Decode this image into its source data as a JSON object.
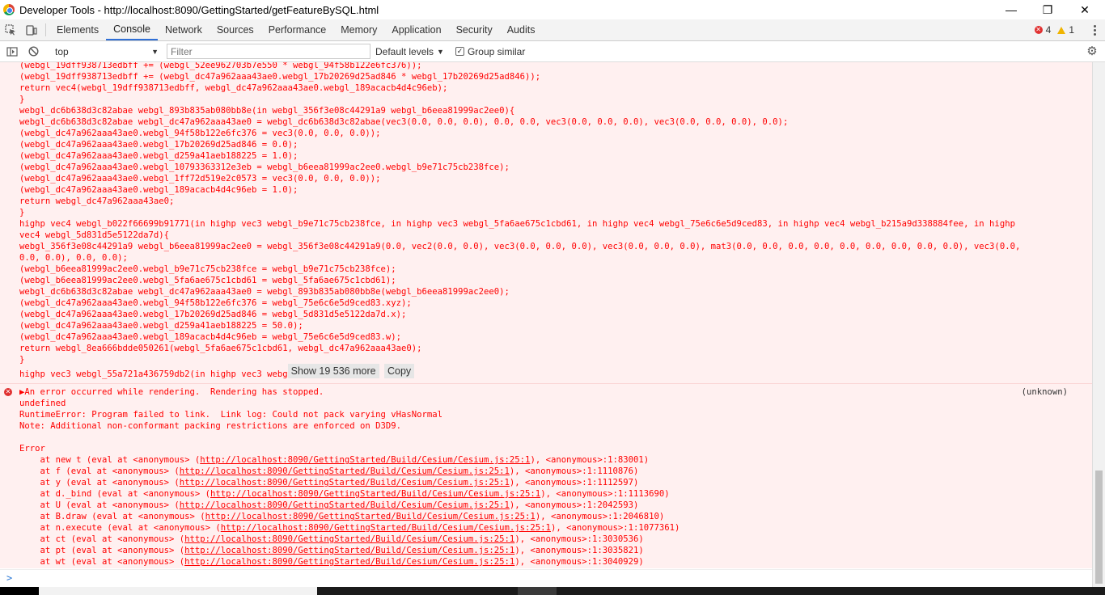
{
  "window": {
    "title": "Developer Tools - http://localhost:8090/GettingStarted/getFeatureBySQL.html",
    "minimize": "—",
    "restore": "❐",
    "close": "✕"
  },
  "tabs": [
    "Elements",
    "Console",
    "Network",
    "Sources",
    "Performance",
    "Memory",
    "Application",
    "Security",
    "Audits"
  ],
  "active_tab": "Console",
  "counts": {
    "errors": "4",
    "warnings": "1"
  },
  "toolbar": {
    "context": "top",
    "filter_placeholder": "Filter",
    "levels": "Default levels",
    "group_similar": "Group similar"
  },
  "code_lines": [
    "(webgl_19dff938713edbff += (webgl_52ee962703b7e550 * webgl_94f58b122e6fc376));",
    "(webgl_19dff938713edbff += (webgl_dc47a962aaa43ae0.webgl_17b20269d25ad846 * webgl_17b20269d25ad846));",
    "return vec4(webgl_19dff938713edbff, webgl_dc47a962aaa43ae0.webgl_189acacb4d4c96eb);",
    "}",
    "webgl_dc6b638d3c82abae webgl_893b835ab080bb8e(in webgl_356f3e08c44291a9 webgl_b6eea81999ac2ee0){",
    "webgl_dc6b638d3c82abae webgl_dc47a962aaa43ae0 = webgl_dc6b638d3c82abae(vec3(0.0, 0.0, 0.0), 0.0, 0.0, vec3(0.0, 0.0, 0.0), vec3(0.0, 0.0, 0.0), 0.0);",
    "(webgl_dc47a962aaa43ae0.webgl_94f58b122e6fc376 = vec3(0.0, 0.0, 0.0));",
    "(webgl_dc47a962aaa43ae0.webgl_17b20269d25ad846 = 0.0);",
    "(webgl_dc47a962aaa43ae0.webgl_d259a41aeb188225 = 1.0);",
    "(webgl_dc47a962aaa43ae0.webgl_10793363312e3eb = webgl_b6eea81999ac2ee0.webgl_b9e71c75cb238fce);",
    "(webgl_dc47a962aaa43ae0.webgl_1ff72d519e2c0573 = vec3(0.0, 0.0, 0.0));",
    "(webgl_dc47a962aaa43ae0.webgl_189acacb4d4c96eb = 1.0);",
    "return webgl_dc47a962aaa43ae0;",
    "}",
    "highp vec4 webgl_b022f66699b91771(in highp vec3 webgl_b9e71c75cb238fce, in highp vec3 webgl_5fa6ae675c1cbd61, in highp vec4 webgl_75e6c6e5d9ced83, in highp vec4 webgl_b215a9d338884fee, in highp",
    "vec4 webgl_5d831d5e5122da7d){",
    "webgl_356f3e08c44291a9 webgl_b6eea81999ac2ee0 = webgl_356f3e08c44291a9(0.0, vec2(0.0, 0.0), vec3(0.0, 0.0, 0.0), vec3(0.0, 0.0, 0.0), mat3(0.0, 0.0, 0.0, 0.0, 0.0, 0.0, 0.0, 0.0, 0.0), vec3(0.0,",
    "0.0, 0.0), 0.0, 0.0);",
    "(webgl_b6eea81999ac2ee0.webgl_b9e71c75cb238fce = webgl_b9e71c75cb238fce);",
    "(webgl_b6eea81999ac2ee0.webgl_5fa6ae675c1cbd61 = webgl_5fa6ae675c1cbd61);",
    "webgl_dc6b638d3c82abae webgl_dc47a962aaa43ae0 = webgl_893b835ab080bb8e(webgl_b6eea81999ac2ee0);",
    "(webgl_dc47a962aaa43ae0.webgl_94f58b122e6fc376 = webgl_75e6c6e5d9ced83.xyz);",
    "(webgl_dc47a962aaa43ae0.webgl_17b20269d25ad846 = webgl_5d831d5e5122da7d.x);",
    "(webgl_dc47a962aaa43ae0.webgl_d259a41aeb188225 = 50.0);",
    "(webgl_dc47a962aaa43ae0.webgl_189acacb4d4c96eb = webgl_75e6c6e5d9ced83.w);",
    "return webgl_8ea666bdde050261(webgl_5fa6ae675c1cbd61, webgl_dc47a962aaa43ae0);",
    "}"
  ],
  "truncated_line": "highp vec3 webgl_55a721a436759db2(in highp vec3 webg",
  "show_more": "Show 19 536 more",
  "copy": "Copy",
  "error": {
    "summary": "▶An error occurred while rendering.  Rendering has stopped.",
    "source": "(unknown)",
    "line_undefined": "undefined",
    "line_runtime": "RuntimeError: Program failed to link.  Link log: Could not pack varying vHasNormal",
    "line_note": "Note: Additional non-conformant packing restrictions are enforced on D3D9.",
    "line_error": "Error",
    "link_url": "http://localhost:8090/GettingStarted/Build/Cesium/Cesium.js:25:1",
    "stack": [
      {
        "pre": "    at new t (eval at <anonymous> (",
        "post": "), <anonymous>:1:83001)"
      },
      {
        "pre": "    at f (eval at <anonymous> (",
        "post": "), <anonymous>:1:1110876)"
      },
      {
        "pre": "    at y (eval at <anonymous> (",
        "post": "), <anonymous>:1:1112597)"
      },
      {
        "pre": "    at d._bind (eval at <anonymous> (",
        "post": "), <anonymous>:1:1113690)"
      },
      {
        "pre": "    at U (eval at <anonymous> (",
        "post": "), <anonymous>:1:2042593)"
      },
      {
        "pre": "    at B.draw (eval at <anonymous> (",
        "post": "), <anonymous>:1:2046810)"
      },
      {
        "pre": "    at n.execute (eval at <anonymous> (",
        "post": "), <anonymous>:1:1077361)"
      },
      {
        "pre": "    at ct (eval at <anonymous> (",
        "post": "), <anonymous>:1:3030536)"
      },
      {
        "pre": "    at pt (eval at <anonymous> (",
        "post": "), <anonymous>:1:3035821)"
      },
      {
        "pre": "    at wt (eval at <anonymous> (",
        "post": "), <anonymous>:1:3040929)"
      }
    ]
  },
  "prompt_symbol": ">"
}
